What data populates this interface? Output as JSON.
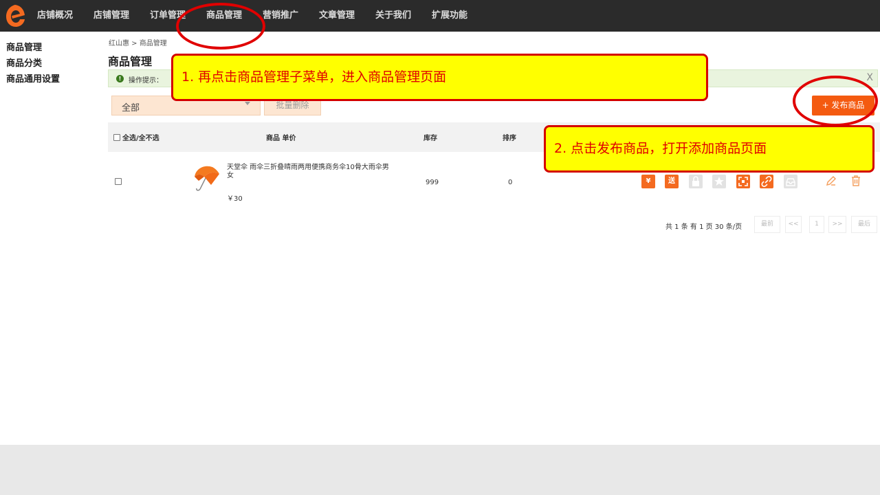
{
  "nav": {
    "items": [
      "店铺概况",
      "店铺管理",
      "订单管理",
      "商品管理",
      "营销推广",
      "文章管理",
      "关于我们",
      "扩展功能"
    ]
  },
  "sidebar": {
    "items": [
      "商品管理",
      "商品分类",
      "商品通用设置"
    ]
  },
  "main": {
    "breadcrumb": "红山惠 > 商品管理",
    "title": "商品管理",
    "tip_label": "操作提示：",
    "tip_close": "X",
    "filter_value": "全部",
    "batch_delete": "批量删除",
    "publish_button": "+ 发布商品"
  },
  "table": {
    "headers": {
      "select_all": "全选/全不选",
      "product_price": "商品 单价",
      "stock": "库存",
      "sort": "排序"
    },
    "rows": [
      {
        "name": "天堂伞 雨伞三折叠晴雨两用便携商务伞10骨大雨伞男女",
        "price": "￥30",
        "stock": "999",
        "sort": "0"
      }
    ]
  },
  "row_ops": [
    "¥",
    "送"
  ],
  "pager": {
    "info": "共 1 条 有 1 页 30 条/页",
    "first": "最前",
    "prev": "<<",
    "page": "1",
    "next": ">>",
    "last": "最后"
  },
  "annotations": {
    "callout1": "1. 再点击商品管理子菜单，进入商品管理页面",
    "callout2": "2. 点击发布商品，打开添加商品页面"
  },
  "colors": {
    "topbar": "#2b2b2b",
    "accent": "#f45a10",
    "annotation_red": "#e00000",
    "annotation_yellow": "#ffff00"
  }
}
